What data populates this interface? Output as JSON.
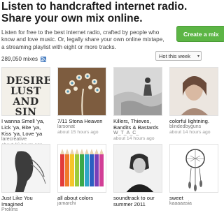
{
  "header": {
    "headline": "Listen to handcrafted internet radio. Share your own mix online.",
    "intro": "Listen for free to the best internet radio, crafted by people who know and love music. Or, legally share your own online mixtape, a streaming playlist with eight or more tracks.",
    "create_button": "Create a mix"
  },
  "toolbar": {
    "mix_count": "289,050 mixes",
    "sort_value": "Hot this week",
    "rss_icon": "rss-icon",
    "chevron_icon": "chevron-down-icon"
  },
  "mixes": [
    {
      "title": "I wanna Smell 'ya, Lick 'ya, Bite 'ya, Kiss 'ya, Love 'ya",
      "user": "larecreative",
      "time": "about 16 hours ago",
      "cover_text": "DESIRE LUST AND SIN"
    },
    {
      "title": "7/11 Stona Heaven",
      "user": "larsonat",
      "time": "about 15 hours ago"
    },
    {
      "title": "Killers, Thieves, Bandits & Bastards",
      "user": "W_T_A_C_",
      "time": "about 14 hours ago"
    },
    {
      "title": "colorful lightning.",
      "user": "blindedbyguns",
      "time": "about 14 hours ago"
    },
    {
      "title": "Just Like You Imagined",
      "user": "Prokins",
      "time": ""
    },
    {
      "title": "all about colors",
      "user": "jamarchi",
      "time": ""
    },
    {
      "title": "soundtrack to our summer 2011",
      "user": "",
      "time": ""
    },
    {
      "title": "sweet",
      "user": "kaaaaasia",
      "time": ""
    }
  ],
  "colors": {
    "accent_green": "#5cb545",
    "headline": "#1a1a1a"
  }
}
